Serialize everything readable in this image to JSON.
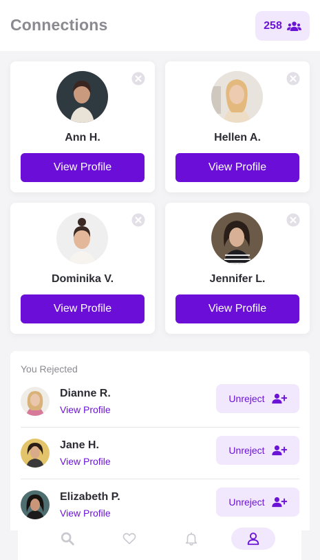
{
  "header": {
    "title": "Connections",
    "count": "258"
  },
  "connections": [
    {
      "name": "Ann H.",
      "button": "View Profile"
    },
    {
      "name": "Hellen A.",
      "button": "View Profile"
    },
    {
      "name": "Dominika V.",
      "button": "View Profile"
    },
    {
      "name": "Jennifer L.",
      "button": "View Profile"
    }
  ],
  "rejected": {
    "title": "You Rejected",
    "items": [
      {
        "name": "Dianne R.",
        "link": "View Profile",
        "button": "Unreject"
      },
      {
        "name": "Jane H.",
        "link": "View Profile",
        "button": "Unreject"
      },
      {
        "name": "Elizabeth P.",
        "link": "View Profile",
        "button": "Unreject"
      }
    ]
  },
  "nav": {
    "items": [
      "search-icon",
      "heart-icon",
      "bell-icon",
      "user-icon"
    ],
    "active": "user-icon"
  },
  "colors": {
    "accent": "#6b0fd8",
    "accent_light": "#f1e8fe",
    "muted": "#8a8a90"
  }
}
